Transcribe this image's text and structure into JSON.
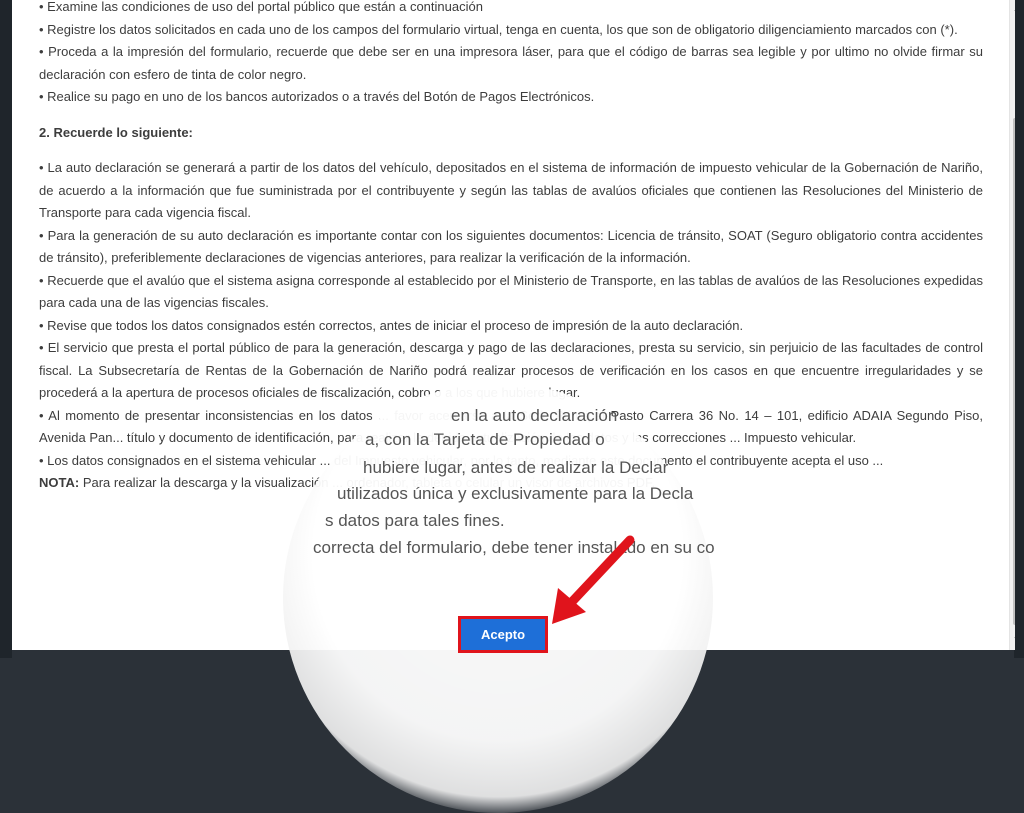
{
  "modal": {
    "line1": "• Examine las condiciones de uso del portal público que están a continuación",
    "line2": "• Registre los datos solicitados en cada uno de los campos del formulario virtual, tenga en cuenta, los que son de obligatorio diligenciamiento marcados con (*).",
    "line3": "• Proceda a la impresión del formulario, recuerde que debe ser en una impresora láser, para que el código de barras sea legible y por ultimo no olvide firmar su declaración con esfero de tinta de color negro.",
    "line4": "• Realice su pago en uno de los bancos autorizados o a través del Botón de Pagos Electrónicos.",
    "section2_title": "2. Recuerde lo siguiente:",
    "item1": "• La auto declaración se generará a partir de los datos del vehículo, depositados en el sistema de información de impuesto vehicular de la Gobernación de Nariño, de acuerdo a la información que fue suministrada por el contribuyente y según las tablas de avalúos oficiales que contienen las Resoluciones del Ministerio de Transporte para cada vigencia fiscal.",
    "item2": "• Para la generación de su auto declaración es importante contar con los siguientes documentos: Licencia de tránsito, SOAT (Seguro obligatorio contra accidentes de tránsito), preferiblemente declaraciones de vigencias anteriores, para realizar la verificación de la información.",
    "item3": "• Recuerde que el avalúo que el sistema asigna corresponde al establecido por el Ministerio de Transporte, en las tablas de avalúos de las Resoluciones expedidas para cada una de las vigencias fiscales.",
    "item4": "• Revise que todos los datos consignados estén correctos, antes de iniciar el proceso de impresión de la auto declaración.",
    "item5": "• El servicio que presta el portal público de para la generación, descarga y pago de las declaraciones, presta su servicio, sin perjuicio de las facultades de control fiscal. La Subsecretaría de Rentas de la Gobernación de Nariño podrá realizar procesos de verificación en los casos en que encuentre irregularidades y se procederá a la apertura de procesos oficiales de fiscalización, cobro o a los que hubiere lugar.",
    "item6": "• Al momento de presentar inconsistencias en los datos ... favor acercarse a la Sede Principal Pasto Carrera 36 No. 14 – 101, edificio ADAIA Segundo Piso, Avenida Pan... título y documento de identificación, para realizar la debida actualización de los datos y las correcciones ... Impuesto vehicular.",
    "item7": "• Los datos consignados en el sistema vehicular ... del Impuesto vehicular, por lo tanto, mediante este documento el contribuyente acepta el uso ...",
    "nota_label": "NOTA:",
    "nota_text": " Para realizar la descarga y la visualización ... ordenador, tableta o celular un visor de archivos PDF."
  },
  "magnifier": {
    "m1": "en la auto declaración",
    "m2": "a, con la Tarjeta de Propiedad o",
    "m3": "hubiere lugar, antes de realizar la Declar",
    "m4": "utilizados única y exclusivamente para la Decla",
    "m5": "s datos para tales fines.",
    "m6": "correcta del formulario, debe tener instalado en su co"
  },
  "accept_label": "Acepto",
  "colors": {
    "button": "#1e6fd8",
    "highlight": "#e0141c",
    "arrow": "#e0141c"
  }
}
